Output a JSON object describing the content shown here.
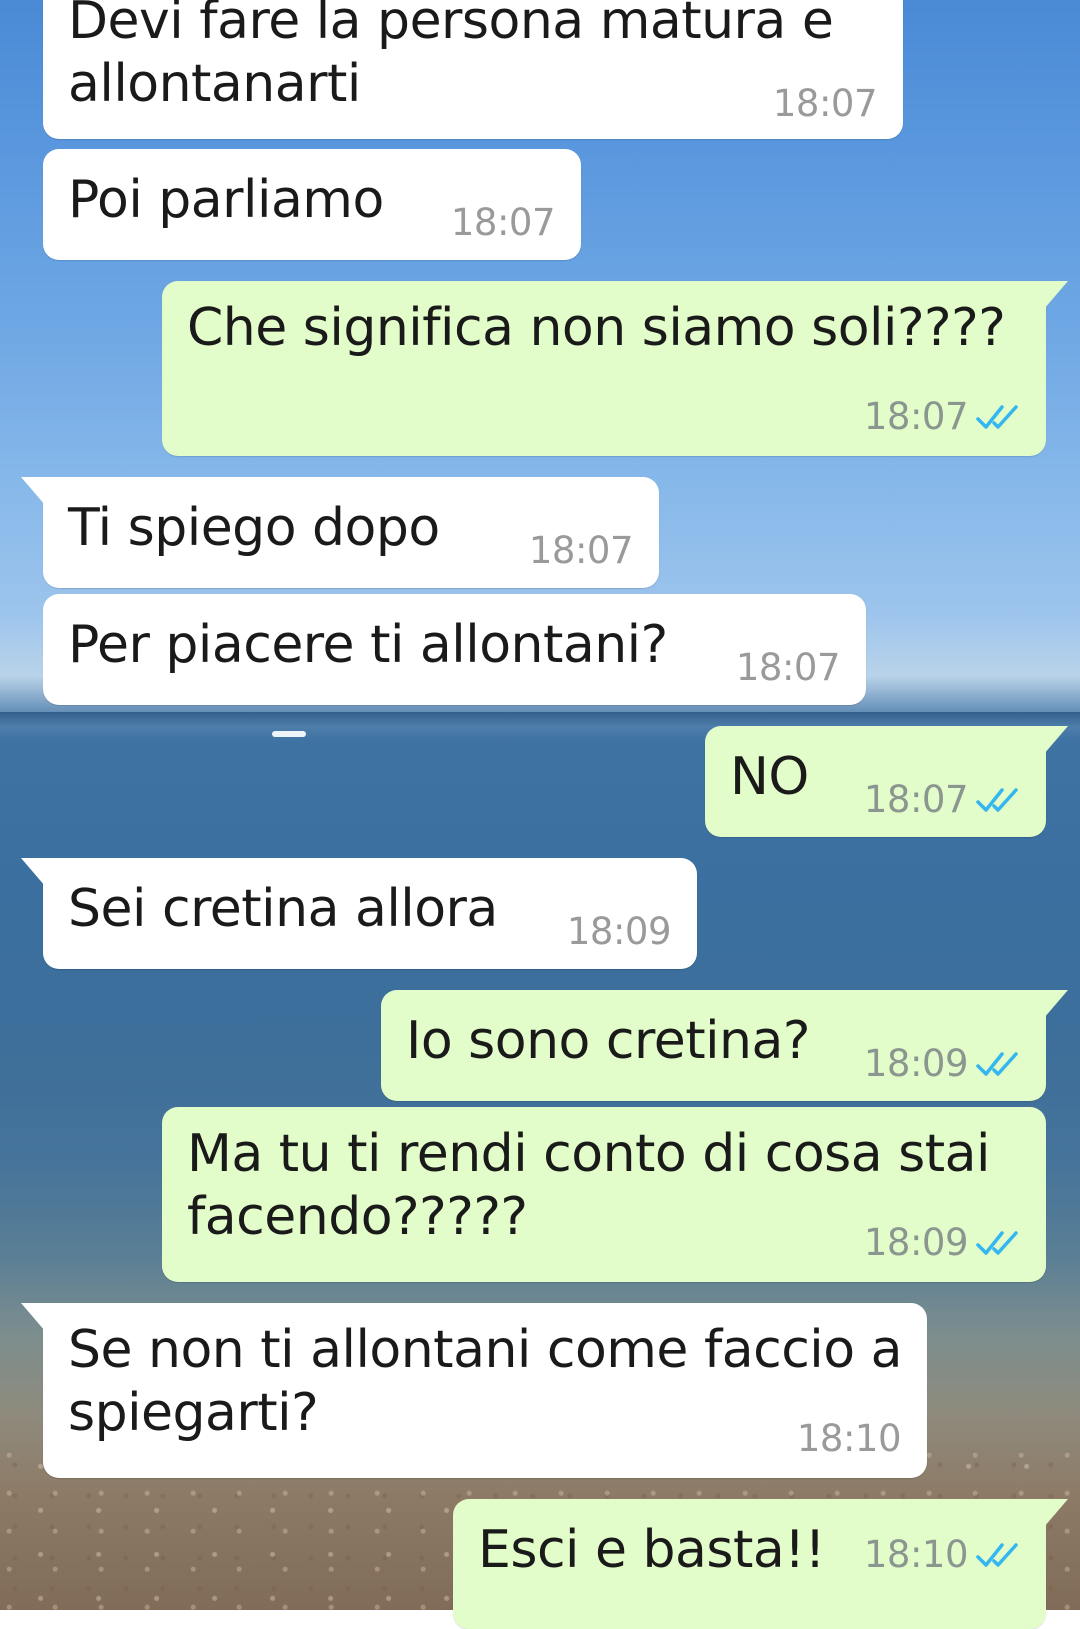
{
  "chat": {
    "messages": [
      {
        "direction": "incoming",
        "text_lines": [
          "Devi fare la persona matura e",
          "allontanarti"
        ],
        "time": "18:07",
        "read_ticks": false
      },
      {
        "direction": "incoming",
        "text_lines": [
          "Poi parliamo"
        ],
        "time": "18:07",
        "read_ticks": false
      },
      {
        "direction": "outgoing",
        "text_lines": [
          "Che significa non siamo soli????"
        ],
        "time": "18:07",
        "read_ticks": true
      },
      {
        "direction": "incoming",
        "text_lines": [
          "Ti spiego dopo"
        ],
        "time": "18:07",
        "read_ticks": false
      },
      {
        "direction": "incoming",
        "text_lines": [
          "Per piacere ti allontani?"
        ],
        "time": "18:07",
        "read_ticks": false
      },
      {
        "direction": "outgoing",
        "text_lines": [
          "NO"
        ],
        "time": "18:07",
        "read_ticks": true
      },
      {
        "direction": "incoming",
        "text_lines": [
          "Sei cretina allora"
        ],
        "time": "18:09",
        "read_ticks": false
      },
      {
        "direction": "outgoing",
        "text_lines": [
          "Io sono cretina?"
        ],
        "time": "18:09",
        "read_ticks": true
      },
      {
        "direction": "outgoing",
        "text_lines": [
          "Ma tu ti rendi conto di cosa stai",
          "facendo?????"
        ],
        "time": "18:09",
        "read_ticks": true
      },
      {
        "direction": "incoming",
        "text_lines": [
          "Se non ti allontani come faccio a",
          "spiegarti?"
        ],
        "time": "18:10",
        "read_ticks": false
      },
      {
        "direction": "outgoing",
        "text_lines": [
          "Esci e basta!!"
        ],
        "time": "18:10",
        "read_ticks": true
      }
    ]
  },
  "colors": {
    "incoming_bubble": "#ffffff",
    "outgoing_bubble": "#e2fdc9",
    "read_tick": "#34b7f1",
    "timestamp": "#8c9690"
  },
  "icons": {
    "read_receipt": "double-check-icon"
  }
}
